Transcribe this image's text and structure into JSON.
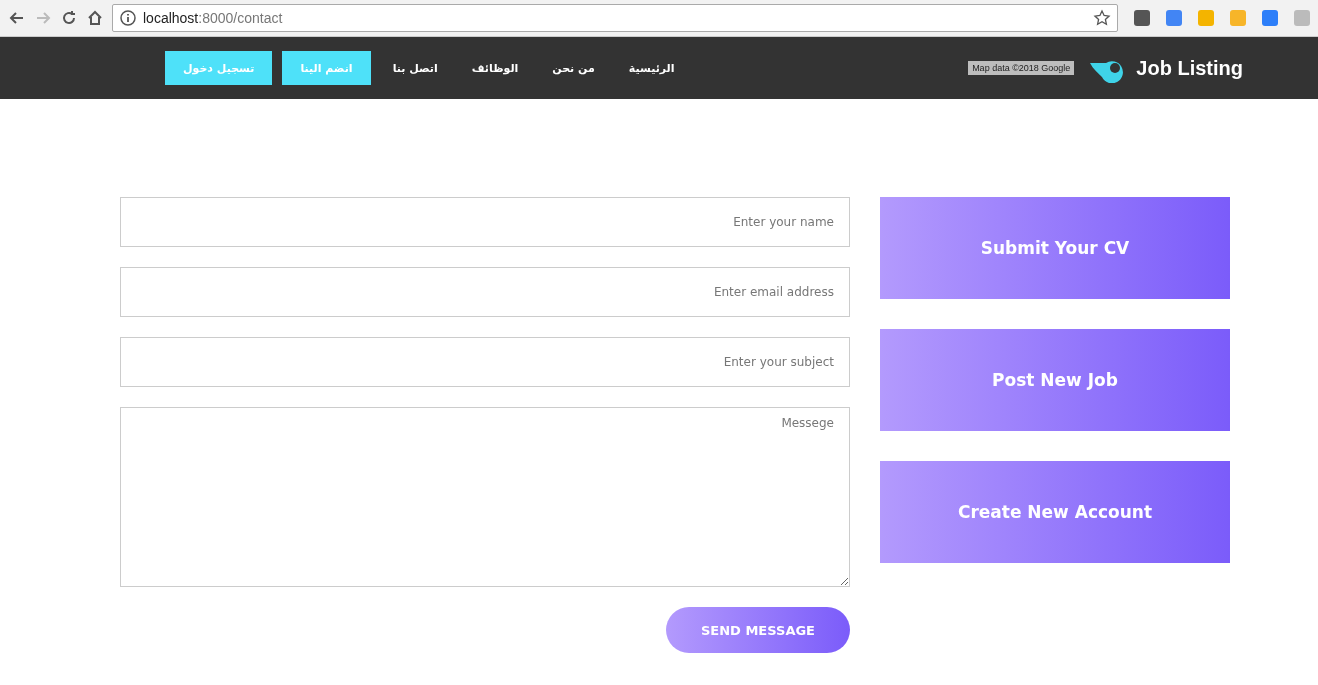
{
  "browser": {
    "url_host": "localhost",
    "url_path": ":8000/contact"
  },
  "header": {
    "logo": "Job Listing",
    "map_attribution": "Map data ©2018 Google",
    "nav": [
      {
        "label": "الرئيسية",
        "kind": "link"
      },
      {
        "label": "من نحن",
        "kind": "link"
      },
      {
        "label": "الوظائف",
        "kind": "link"
      },
      {
        "label": "اتصل بنا",
        "kind": "link"
      },
      {
        "label": "انضم الينا",
        "kind": "button"
      },
      {
        "label": "تسجيل دخول",
        "kind": "button"
      }
    ]
  },
  "form": {
    "fields": [
      {
        "placeholder": "Enter your name",
        "kind": "input"
      },
      {
        "placeholder": "Enter email address",
        "kind": "input"
      },
      {
        "placeholder": "Enter your subject",
        "kind": "input"
      },
      {
        "placeholder": "Messege",
        "kind": "textarea"
      }
    ],
    "submit": "SEND MESSAGE"
  },
  "actions": [
    "Submit Your CV",
    "Post New Job",
    "Create New Account"
  ]
}
